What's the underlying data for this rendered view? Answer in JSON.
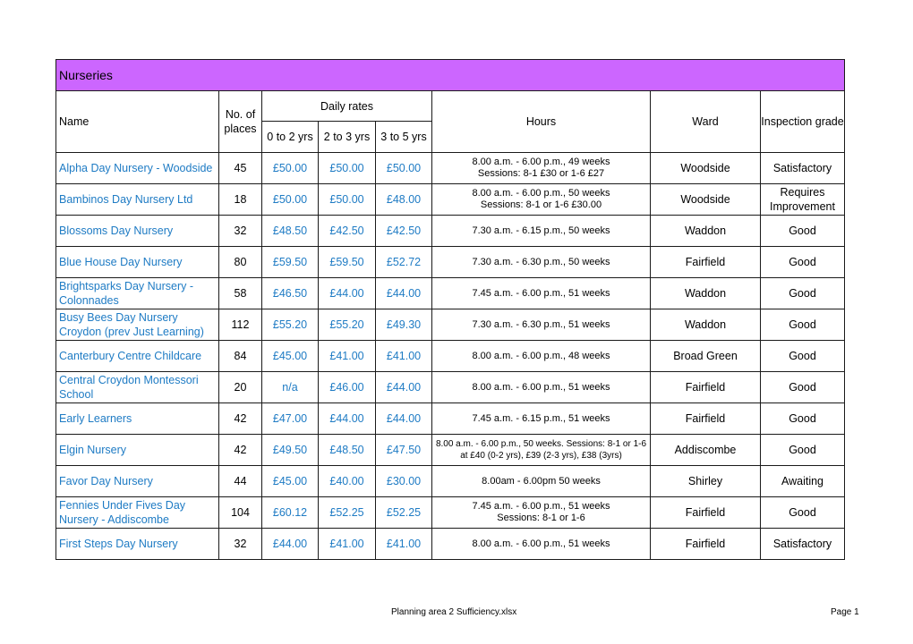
{
  "title": "Nurseries",
  "headers": {
    "name": "Name",
    "places": "No. of places",
    "daily_rates": "Daily rates",
    "rate_0_2": "0 to 2 yrs",
    "rate_2_3": "2 to 3 yrs",
    "rate_3_5": "3 to 5 yrs",
    "hours": "Hours",
    "ward": "Ward",
    "grade": "Inspection grade"
  },
  "rows": [
    {
      "name": "Alpha Day Nursery - Woodside",
      "places": "45",
      "r02": "£50.00",
      "r23": "£50.00",
      "r35": "£50.00",
      "hours": "8.00 a.m. - 6.00 p.m., 49 weeks\nSessions: 8-1 £30 or 1-6 £27",
      "ward": "Woodside",
      "grade": "Satisfactory"
    },
    {
      "name": "Bambinos Day Nursery Ltd",
      "places": "18",
      "r02": "£50.00",
      "r23": "£50.00",
      "r35": "£48.00",
      "hours": "8.00 a.m. - 6.00 p.m., 50 weeks\nSessions: 8-1 or 1-6 £30.00",
      "ward": "Woodside",
      "grade": "Requires Improvement"
    },
    {
      "name": "Blossoms Day Nursery",
      "places": "32",
      "r02": "£48.50",
      "r23": "£42.50",
      "r35": "£42.50",
      "hours": "7.30 a.m. - 6.15 p.m., 50 weeks",
      "ward": "Waddon",
      "grade": "Good"
    },
    {
      "name": "Blue House Day Nursery",
      "places": "80",
      "r02": "£59.50",
      "r23": "£59.50",
      "r35": "£52.72",
      "hours": "7.30 a.m. - 6.30 p.m., 50 weeks",
      "ward": "Fairfield",
      "grade": "Good"
    },
    {
      "name": "Brightsparks Day Nursery - Colonnades",
      "places": "58",
      "r02": "£46.50",
      "r23": "£44.00",
      "r35": "£44.00",
      "hours": "7.45 a.m. - 6.00 p.m., 51 weeks",
      "ward": "Waddon",
      "grade": "Good"
    },
    {
      "name": "Busy Bees Day Nursery Croydon (prev Just Learning)",
      "places": "112",
      "r02": "£55.20",
      "r23": "£55.20",
      "r35": "£49.30",
      "hours": "7.30 a.m. - 6.30 p.m., 51 weeks",
      "ward": "Waddon",
      "grade": "Good"
    },
    {
      "name": "Canterbury Centre Childcare",
      "places": "84",
      "r02": "£45.00",
      "r23": "£41.00",
      "r35": "£41.00",
      "hours": "8.00 a.m. - 6.00 p.m., 48 weeks",
      "ward": "Broad Green",
      "grade": "Good"
    },
    {
      "name": "Central Croydon Montessori School",
      "places": "20",
      "r02": "n/a",
      "r23": "£46.00",
      "r35": "£44.00",
      "hours": "8.00 a.m. - 6.00 p.m., 51 weeks",
      "ward": "Fairfield",
      "grade": "Good"
    },
    {
      "name": "Early Learners",
      "places": "42",
      "r02": "£47.00",
      "r23": "£44.00",
      "r35": "£44.00",
      "hours": "7.45 a.m. - 6.15 p.m., 51 weeks",
      "ward": "Fairfield",
      "grade": "Good"
    },
    {
      "name": "Elgin Nursery",
      "places": "42",
      "r02": "£49.50",
      "r23": "£48.50",
      "r35": "£47.50",
      "hours": "8.00 a.m. - 6.00 p.m., 50 weeks. Sessions: 8-1 or 1-6 at £40 (0-2 yrs), £39 (2-3 yrs), £38 (3yrs)",
      "ward": "Addiscombe",
      "grade": "Good"
    },
    {
      "name": "Favor Day Nursery",
      "places": "44",
      "r02": "£45.00",
      "r23": "£40.00",
      "r35": "£30.00",
      "hours": "8.00am - 6.00pm 50 weeks",
      "ward": "Shirley",
      "grade": "Awaiting"
    },
    {
      "name": "Fennies Under Fives Day Nursery - Addiscombe",
      "places": "104",
      "r02": "£60.12",
      "r23": "£52.25",
      "r35": "£52.25",
      "hours": "7.45 a.m. - 6.00 p.m., 51 weeks\nSessions: 8-1 or 1-6",
      "ward": "Fairfield",
      "grade": "Good"
    },
    {
      "name": "First Steps Day Nursery",
      "places": "32",
      "r02": "£44.00",
      "r23": "£41.00",
      "r35": "£41.00",
      "hours": "8.00 a.m. - 6.00 p.m., 51 weeks",
      "ward": "Fairfield",
      "grade": "Satisfactory"
    }
  ],
  "footer": {
    "filename": "Planning area 2 Sufficiency.xlsx",
    "page": "Page 1"
  }
}
